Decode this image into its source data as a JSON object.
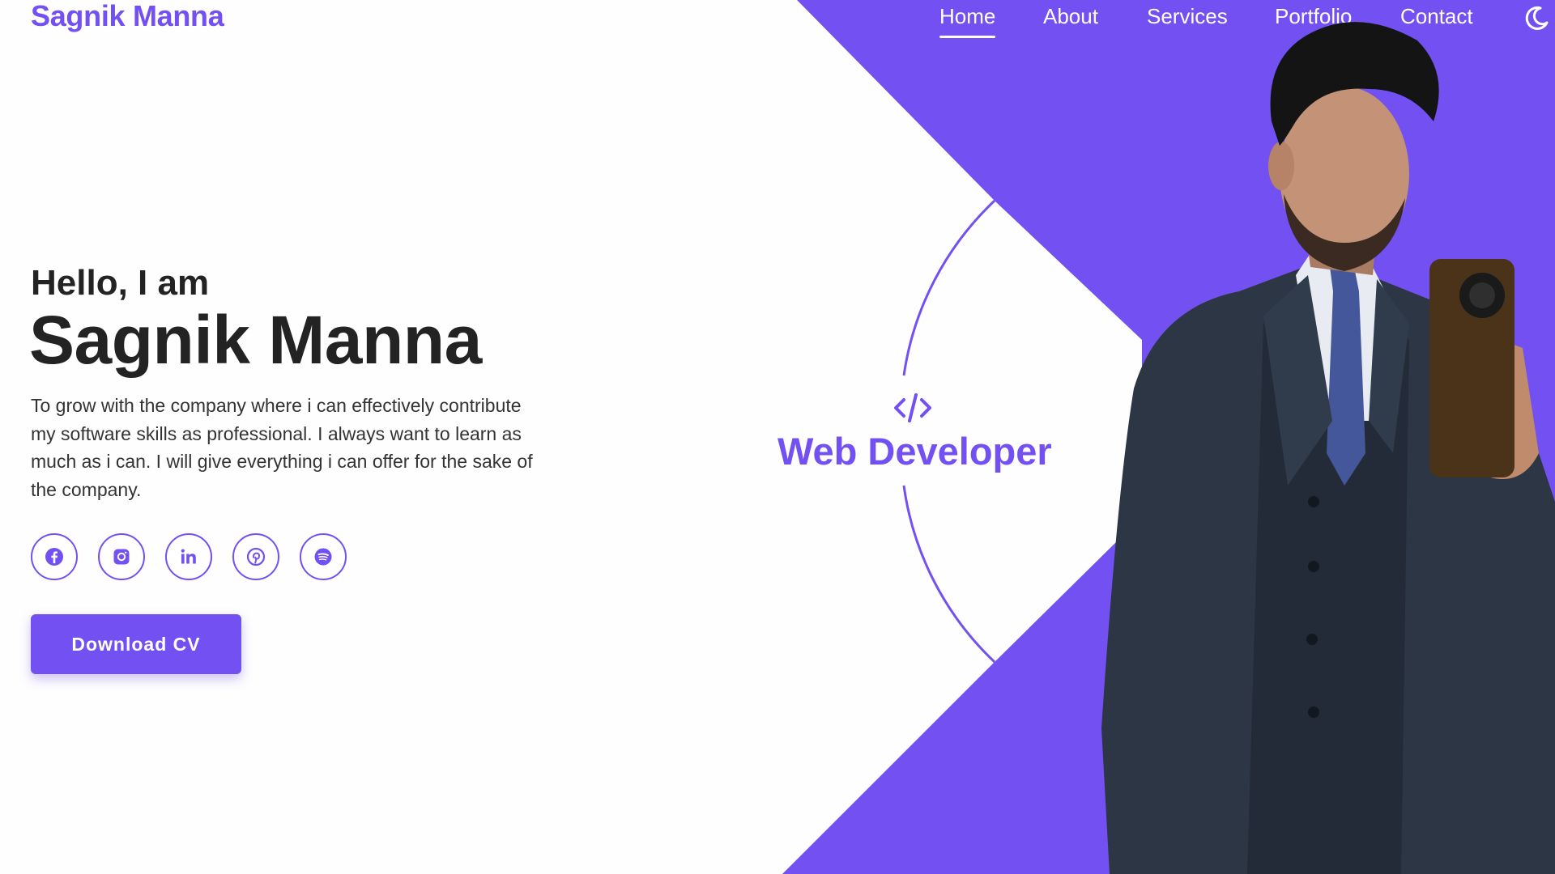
{
  "brand": {
    "name": "Sagnik Manna",
    "color": "#7350f1"
  },
  "nav": {
    "items": [
      {
        "label": "Home",
        "active": true
      },
      {
        "label": "About",
        "active": false
      },
      {
        "label": "Services",
        "active": false
      },
      {
        "label": "Portfolio",
        "active": false
      },
      {
        "label": "Contact",
        "active": false
      }
    ],
    "theme_toggle_icon": "moon-icon"
  },
  "hero": {
    "greeting": "Hello, I am",
    "name": "Sagnik Manna",
    "description": "To grow with the company where i can effectively contribute my software skills as professional. I always want to learn as much as i can. I will give everything i can offer for the sake of the company.",
    "socials": [
      {
        "icon": "facebook-icon"
      },
      {
        "icon": "instagram-icon"
      },
      {
        "icon": "linkedin-icon"
      },
      {
        "icon": "pinterest-icon"
      },
      {
        "icon": "spotify-icon"
      }
    ],
    "cta_label": "Download CV"
  },
  "role": {
    "icon": "code-icon",
    "title": "Web Developer"
  },
  "theme": {
    "accent": "#7350f1",
    "text": "#232323",
    "background": "#fefefe"
  }
}
